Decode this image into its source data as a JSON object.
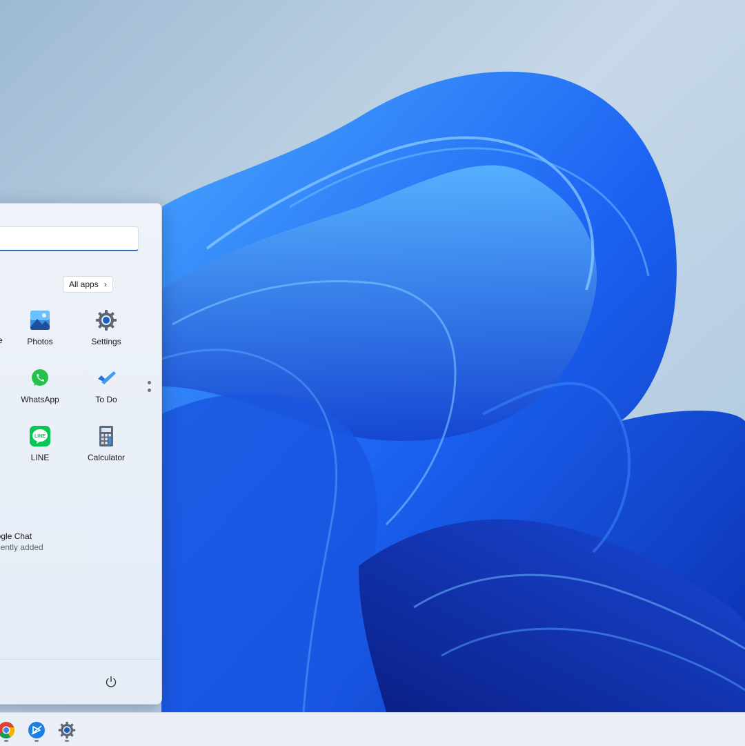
{
  "start_menu": {
    "search": {
      "placeholder": ""
    },
    "all_apps_label": "All apps",
    "pinned_apps": [
      {
        "label": "Photos",
        "icon": "photos-icon"
      },
      {
        "label": "Settings",
        "icon": "settings-gear-icon"
      },
      {
        "label": "WhatsApp",
        "icon": "whatsapp-icon"
      },
      {
        "label": "To Do",
        "icon": "todo-icon"
      },
      {
        "label": "LINE",
        "icon": "line-icon"
      },
      {
        "label": "Calculator",
        "icon": "calculator-icon"
      }
    ],
    "partial_label": "e",
    "recommended": {
      "title": "oogle Chat",
      "subtitle": "ecently added"
    }
  },
  "taskbar": {
    "icons": [
      "chrome-icon",
      "app-icon",
      "settings-gear-icon"
    ]
  },
  "colors": {
    "accent": "#2f6db8",
    "wallpaper_blue": "#1e5ee8"
  }
}
